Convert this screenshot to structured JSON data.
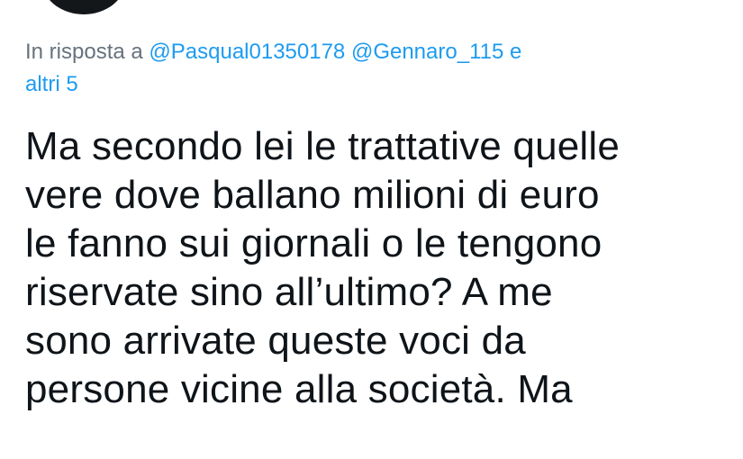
{
  "reply": {
    "prefix": "In risposta a",
    "mentions": [
      "@Pasqual01350178",
      "@Gennaro_115"
    ],
    "connector": "e",
    "others": "altri 5"
  },
  "tweet": {
    "lines": [
      "Ma secondo lei le trattative quelle",
      "vere dove ballano milioni di euro",
      "le fanno sui giornali o le tengono",
      "riservate sino all’ultimo? A me",
      "sono arrivate queste voci da",
      "persone vicine alla società. Ma"
    ]
  },
  "colors": {
    "accent": "#1d9bf0",
    "secondary_text": "#66727d",
    "primary_text": "#0f1419",
    "avatar": "#14171a"
  }
}
